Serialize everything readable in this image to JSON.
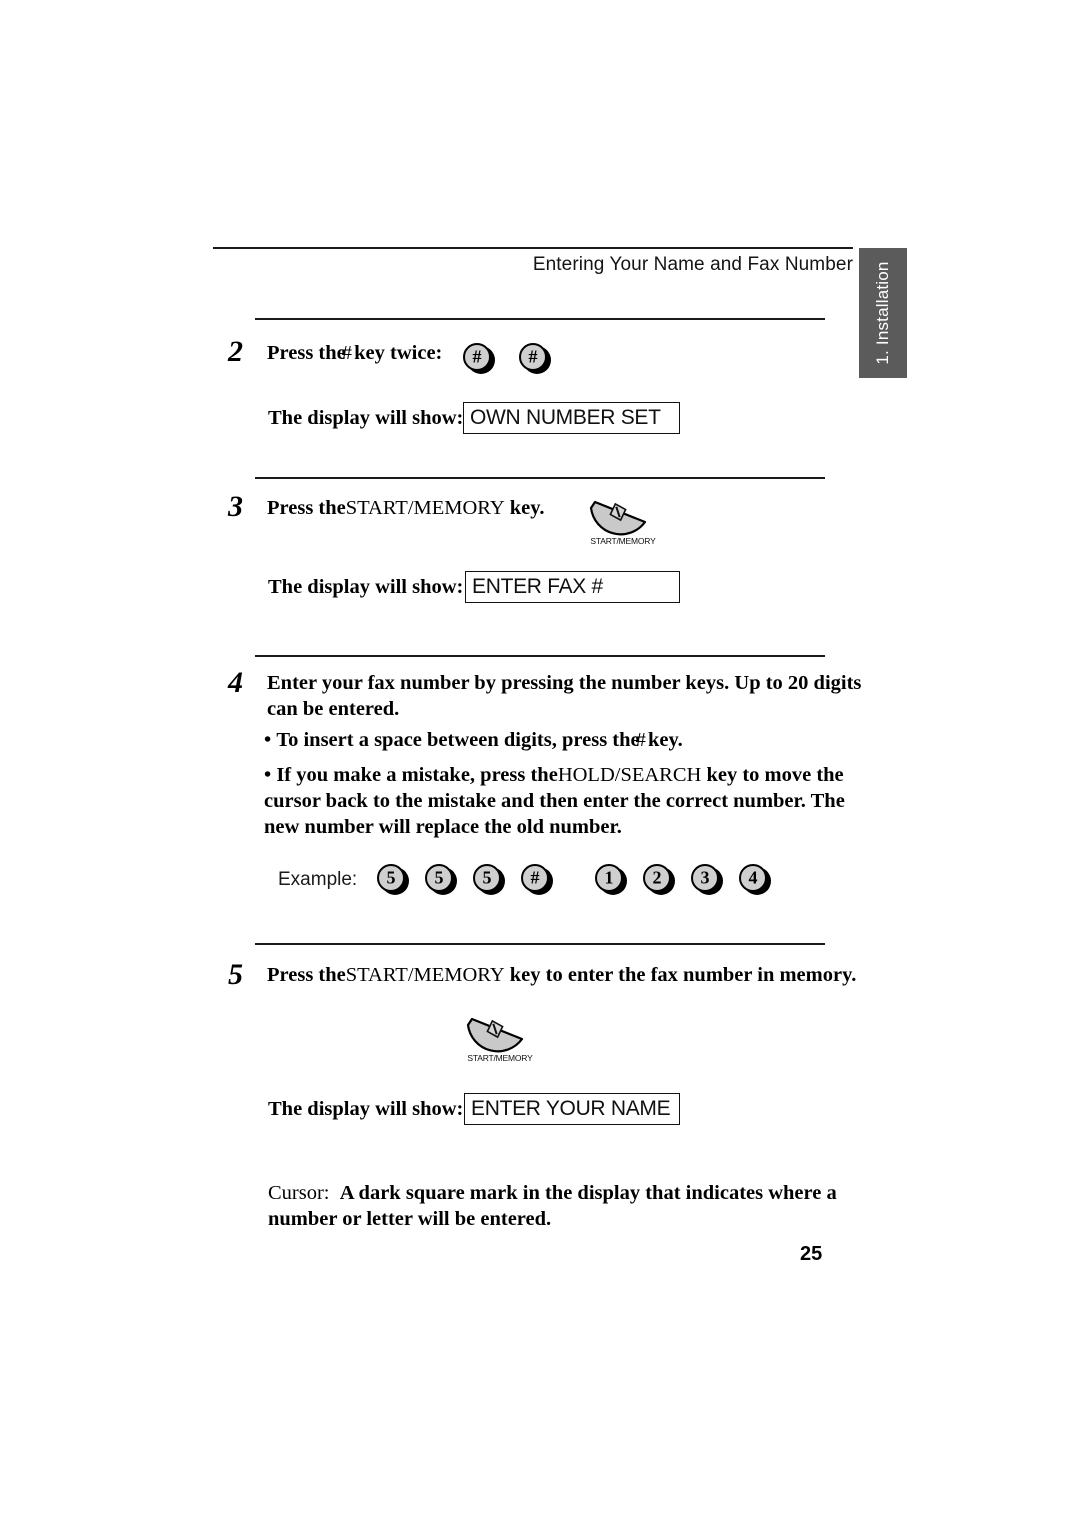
{
  "header": {
    "title": "Entering Your Name and Fax Number"
  },
  "side_tab": {
    "label": "1. Installation",
    "background_color": "#5b5b5b",
    "text_color": "#ffffff"
  },
  "steps": [
    {
      "number": "2",
      "instruction_pre": "Press the",
      "instruction_key": "#",
      "instruction_post": " key twice:",
      "keys": [
        "#",
        "#"
      ],
      "display_label": "The display will show:",
      "display_value": "OWN NUMBER SET"
    },
    {
      "number": "3",
      "instruction_pre": "Press the",
      "instruction_key": "START/MEMORY",
      "instruction_post": " key.",
      "button_caption": "START/MEMORY",
      "display_label": "The display will show:",
      "display_value": "ENTER FAX #"
    },
    {
      "number": "4",
      "instruction": "Enter your fax number by pressing the number keys. Up to 20 digits can be entered.",
      "bullets": [
        {
          "pre": "To insert a space between digits, press the",
          "key": "#",
          "post": " key."
        },
        {
          "pre": "If you make a mistake, press the",
          "key": "HOLD/SEARCH",
          "post": " key to move the cursor back to the mistake and then enter the correct number. The new number will replace the old number."
        }
      ],
      "example_label": "Example:",
      "example_keys": [
        "5",
        "5",
        "5",
        "#",
        "1",
        "2",
        "3",
        "4"
      ]
    },
    {
      "number": "5",
      "instruction_pre": "Press the",
      "instruction_key": "START/MEMORY",
      "instruction_post": " key to enter the fax number in memory.",
      "button_caption": "START/MEMORY",
      "display_label": "The display will show:",
      "display_value": "ENTER YOUR NAME"
    }
  ],
  "cursor_note": {
    "term": "Cursor:",
    "definition": "A dark square mark in the display that indicates where a number or letter will be entered."
  },
  "page_number": "25"
}
